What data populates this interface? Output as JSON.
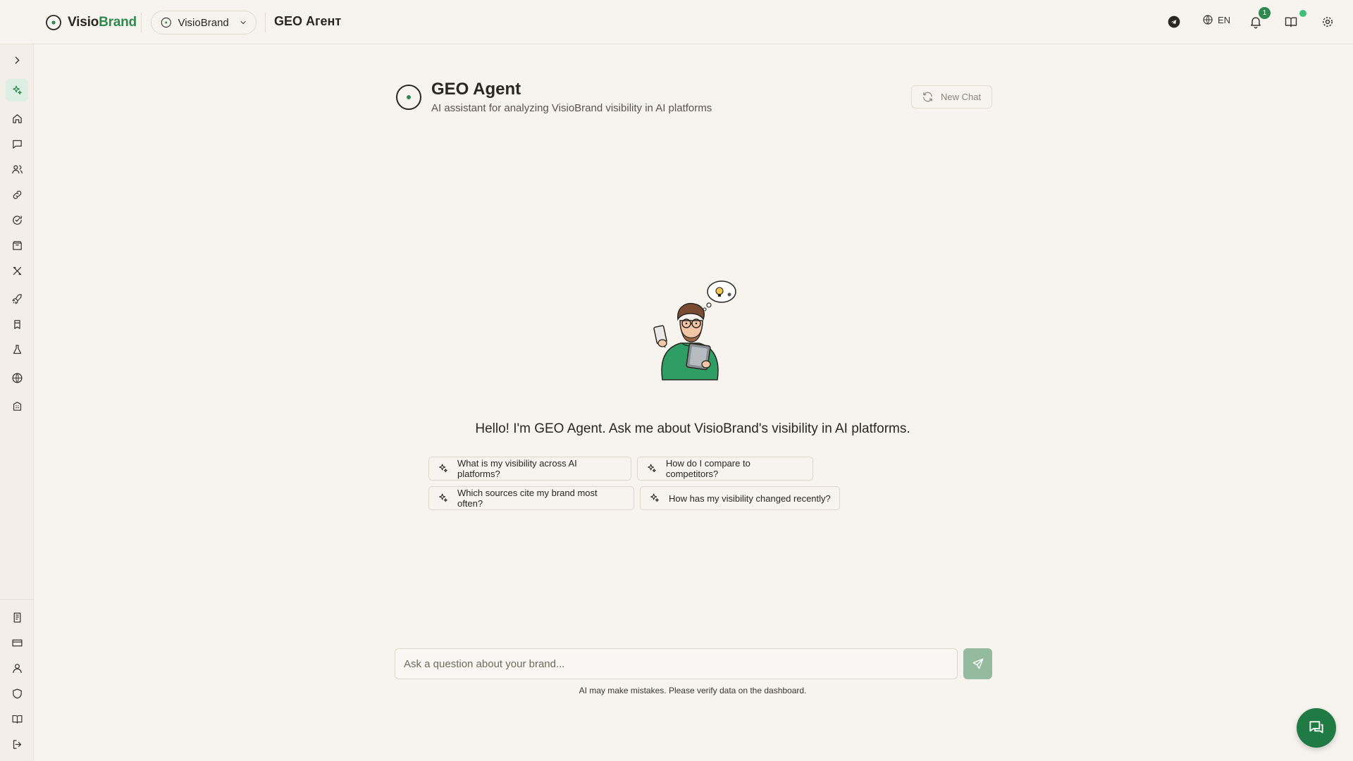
{
  "app": {
    "logo_prefix": "Visio",
    "logo_suffix": "Brand",
    "brand_selector": "VisioBrand",
    "page_heading": "GEO Агент"
  },
  "topbar": {
    "language": "EN",
    "notification_count": "1",
    "icons": [
      "telegram-icon",
      "globe-icon",
      "bell-icon",
      "book-icon",
      "settings-icon"
    ]
  },
  "sidebar": {
    "items": [
      "expand",
      "geo-agent",
      "home",
      "chat",
      "users",
      "link",
      "refresh",
      "package",
      "tools",
      "rocket",
      "bookmark",
      "flask",
      "globe",
      "building"
    ],
    "bottom_items": [
      "report",
      "billing",
      "profile",
      "security",
      "docs",
      "logout"
    ]
  },
  "agent": {
    "title": "GEO Agent",
    "subtitle": "AI assistant for analyzing VisioBrand visibility in AI platforms",
    "new_chat_label": "New Chat"
  },
  "chat": {
    "greeting": "Hello! I'm GEO Agent. Ask me about VisioBrand's visibility in AI platforms.",
    "suggestions": [
      "What is my visibility across AI platforms?",
      "How do I compare to competitors?",
      "Which sources cite my brand most often?",
      "How has my visibility changed recently?"
    ],
    "input_placeholder": "Ask a question about your brand...",
    "disclaimer": "AI may make mistakes. Please verify data on the dashboard."
  },
  "colors": {
    "accent": "#2d8a4e",
    "send_button": "#94bb9d",
    "support_button": "#1f7a43",
    "background": "#f7f4ef"
  }
}
